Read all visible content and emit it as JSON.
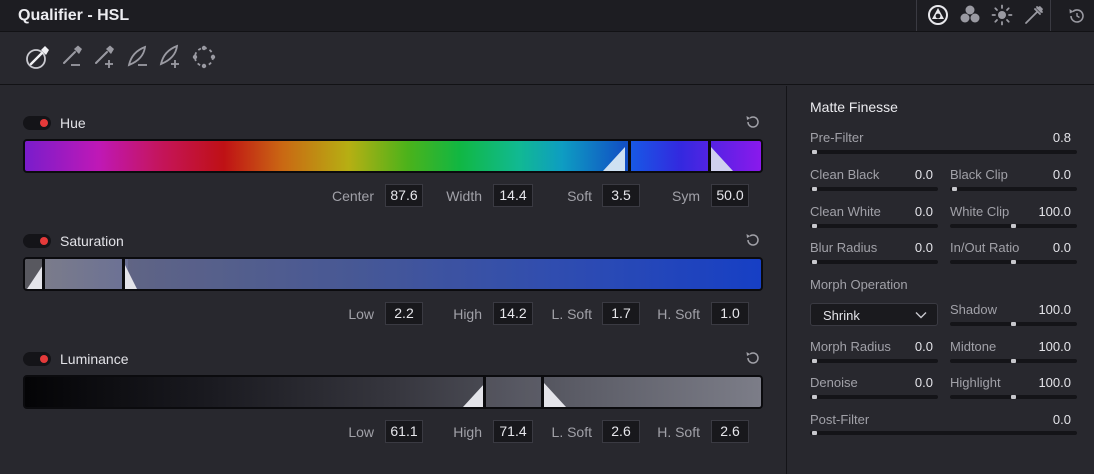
{
  "header": {
    "title": "Qualifier - HSL"
  },
  "icons": {
    "header": [
      "qualifier-hsl-icon",
      "qualifier-rgb-icon",
      "qualifier-luma-icon",
      "qualifier-3d-icon",
      "reset-icon"
    ],
    "tools": [
      "picker-icon",
      "picker-subtract-icon",
      "picker-add-icon",
      "feather-subtract-icon",
      "feather-add-icon",
      "invert-icon"
    ]
  },
  "hue": {
    "label": "Hue",
    "params": [
      {
        "label": "Center",
        "value": "87.6"
      },
      {
        "label": "Width",
        "value": "14.4"
      },
      {
        "label": "Soft",
        "value": "3.5"
      },
      {
        "label": "Sym",
        "value": "50.0"
      }
    ]
  },
  "saturation": {
    "label": "Saturation",
    "params": [
      {
        "label": "Low",
        "value": "2.2"
      },
      {
        "label": "High",
        "value": "14.2"
      },
      {
        "label": "L. Soft",
        "value": "1.7"
      },
      {
        "label": "H. Soft",
        "value": "1.0"
      }
    ]
  },
  "luminance": {
    "label": "Luminance",
    "params": [
      {
        "label": "Low",
        "value": "61.1"
      },
      {
        "label": "High",
        "value": "71.4"
      },
      {
        "label": "L. Soft",
        "value": "2.6"
      },
      {
        "label": "H. Soft",
        "value": "2.6"
      }
    ]
  },
  "matte": {
    "title": "Matte Finesse",
    "pre_filter": {
      "label": "Pre-Filter",
      "value": "0.8"
    },
    "clean_black": {
      "label": "Clean Black",
      "value": "0.0"
    },
    "black_clip": {
      "label": "Black Clip",
      "value": "0.0"
    },
    "clean_white": {
      "label": "Clean White",
      "value": "0.0"
    },
    "white_clip": {
      "label": "White Clip",
      "value": "100.0"
    },
    "blur_radius": {
      "label": "Blur Radius",
      "value": "0.0"
    },
    "in_out_ratio": {
      "label": "In/Out Ratio",
      "value": "0.0"
    },
    "morph_operation": {
      "label": "Morph Operation",
      "selected": "Shrink"
    },
    "shadow": {
      "label": "Shadow",
      "value": "100.0"
    },
    "morph_radius": {
      "label": "Morph Radius",
      "value": "0.0"
    },
    "midtone": {
      "label": "Midtone",
      "value": "100.0"
    },
    "denoise": {
      "label": "Denoise",
      "value": "0.0"
    },
    "highlight": {
      "label": "Highlight",
      "value": "100.0"
    },
    "post_filter": {
      "label": "Post-Filter",
      "value": "0.0"
    }
  },
  "colors": {
    "toggle_on": "#e53a3a",
    "panel_bg": "#28282e",
    "header_bg": "#1d1d22"
  }
}
